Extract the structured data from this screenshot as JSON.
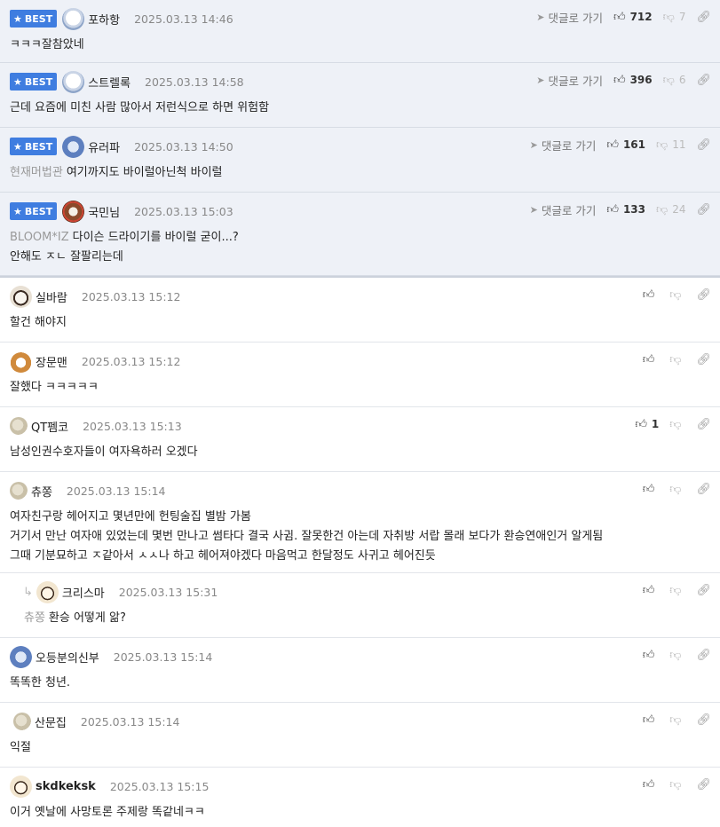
{
  "goto_label": "댓글로 가기",
  "best_label": "BEST",
  "best": [
    {
      "nick": "포하항",
      "date": "2025.03.13 14:46",
      "likes": "712",
      "dislikes": "7",
      "reply_to": "",
      "lines": [
        "ㅋㅋㅋ잘참았네"
      ],
      "avatar": "white"
    },
    {
      "nick": "스트렐록",
      "date": "2025.03.13 14:58",
      "likes": "396",
      "dislikes": "6",
      "reply_to": "",
      "lines": [
        "근데 요즘에 미친 사람 많아서 저런식으로 하면 위험함"
      ],
      "avatar": "white"
    },
    {
      "nick": "유러파",
      "date": "2025.03.13 14:50",
      "likes": "161",
      "dislikes": "11",
      "reply_to": "현재머법관",
      "lines": [
        "여기까지도 바이럴아닌척 바이럴"
      ],
      "avatar": "blue"
    },
    {
      "nick": "국민님",
      "date": "2025.03.13 15:03",
      "likes": "133",
      "dislikes": "24",
      "reply_to": "BLOOM*IZ",
      "lines": [
        "다이슨 드라이기를 바이럴 굳이...?",
        "안해도 ㅈㄴ 잘팔리는데"
      ],
      "avatar": "bear"
    }
  ],
  "comments": [
    {
      "nick": "실바람",
      "date": "2025.03.13 15:12",
      "likes": "",
      "lines": [
        "할건 해야지"
      ],
      "avatar": "dog"
    },
    {
      "nick": "장문맨",
      "date": "2025.03.13 15:12",
      "likes": "",
      "lines": [
        "잘했다 ㅋㅋㅋㅋㅋ"
      ],
      "avatar": "fox"
    },
    {
      "nick": "QT펨코",
      "date": "2025.03.13 15:13",
      "likes": "1",
      "lines": [
        "남성인권수호자들이 여자욕하러 오겠다"
      ],
      "avatar": "blob"
    },
    {
      "nick": "츄쫑",
      "date": "2025.03.13 15:14",
      "likes": "",
      "lines": [
        "여자친구랑 헤어지고 몇년만에 헌팅술집 별밤 가봄",
        "거기서 만난 여자애 있었는데 몇번 만나고 썸타다 결국 사귐. 잘못한건 아는데 자취방 서랍 몰래 보다가 환승연애인거 알게됨",
        "그때 기분묘하고 ㅈ같아서 ㅅㅅ나 하고 헤어져야겠다 마음먹고 한달정도 사귀고 헤어진듯"
      ],
      "avatar": "blob"
    },
    {
      "nick": "크리스마",
      "date": "2025.03.13 15:31",
      "likes": "",
      "reply_to": "츄쫑",
      "lines": [
        "환승 어떻게 앎?"
      ],
      "avatar": "puppy"
    },
    {
      "nick": "오등분의신부",
      "date": "2025.03.13 15:14",
      "likes": "",
      "lines": [
        "똑똑한 청년."
      ],
      "avatar": "blue"
    },
    {
      "nick": "산문집",
      "date": "2025.03.13 15:14",
      "likes": "",
      "lines": [
        "익절"
      ],
      "avatar": "blob"
    },
    {
      "nick": "skdkeksk",
      "date": "2025.03.13 15:15",
      "likes": "",
      "lines": [
        "이거 옛날에 사망토론 주제랑 똑같네ㅋㅋ"
      ],
      "avatar": "puppy"
    }
  ]
}
